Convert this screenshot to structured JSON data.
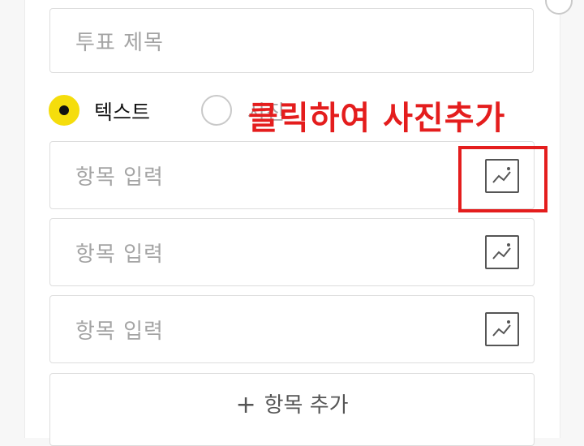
{
  "poll": {
    "title_placeholder": "투표 제목",
    "type_options": [
      {
        "label": "텍스트",
        "selected": true
      },
      {
        "label": "사진",
        "selected": false
      }
    ],
    "items": [
      {
        "placeholder": "항목 입력",
        "icon": "image-icon"
      },
      {
        "placeholder": "항목 입력",
        "icon": "image-icon"
      },
      {
        "placeholder": "항목 입력",
        "icon": "image-icon"
      }
    ],
    "add_item_plus": "+",
    "add_item_label": "항목 추가"
  },
  "annotation": {
    "text": "클릭하여 사진추가",
    "color": "#e41d1d"
  },
  "colors": {
    "accent": "#f5dd0c",
    "annotation": "#e41d1d",
    "placeholder": "#a4a4a4"
  }
}
